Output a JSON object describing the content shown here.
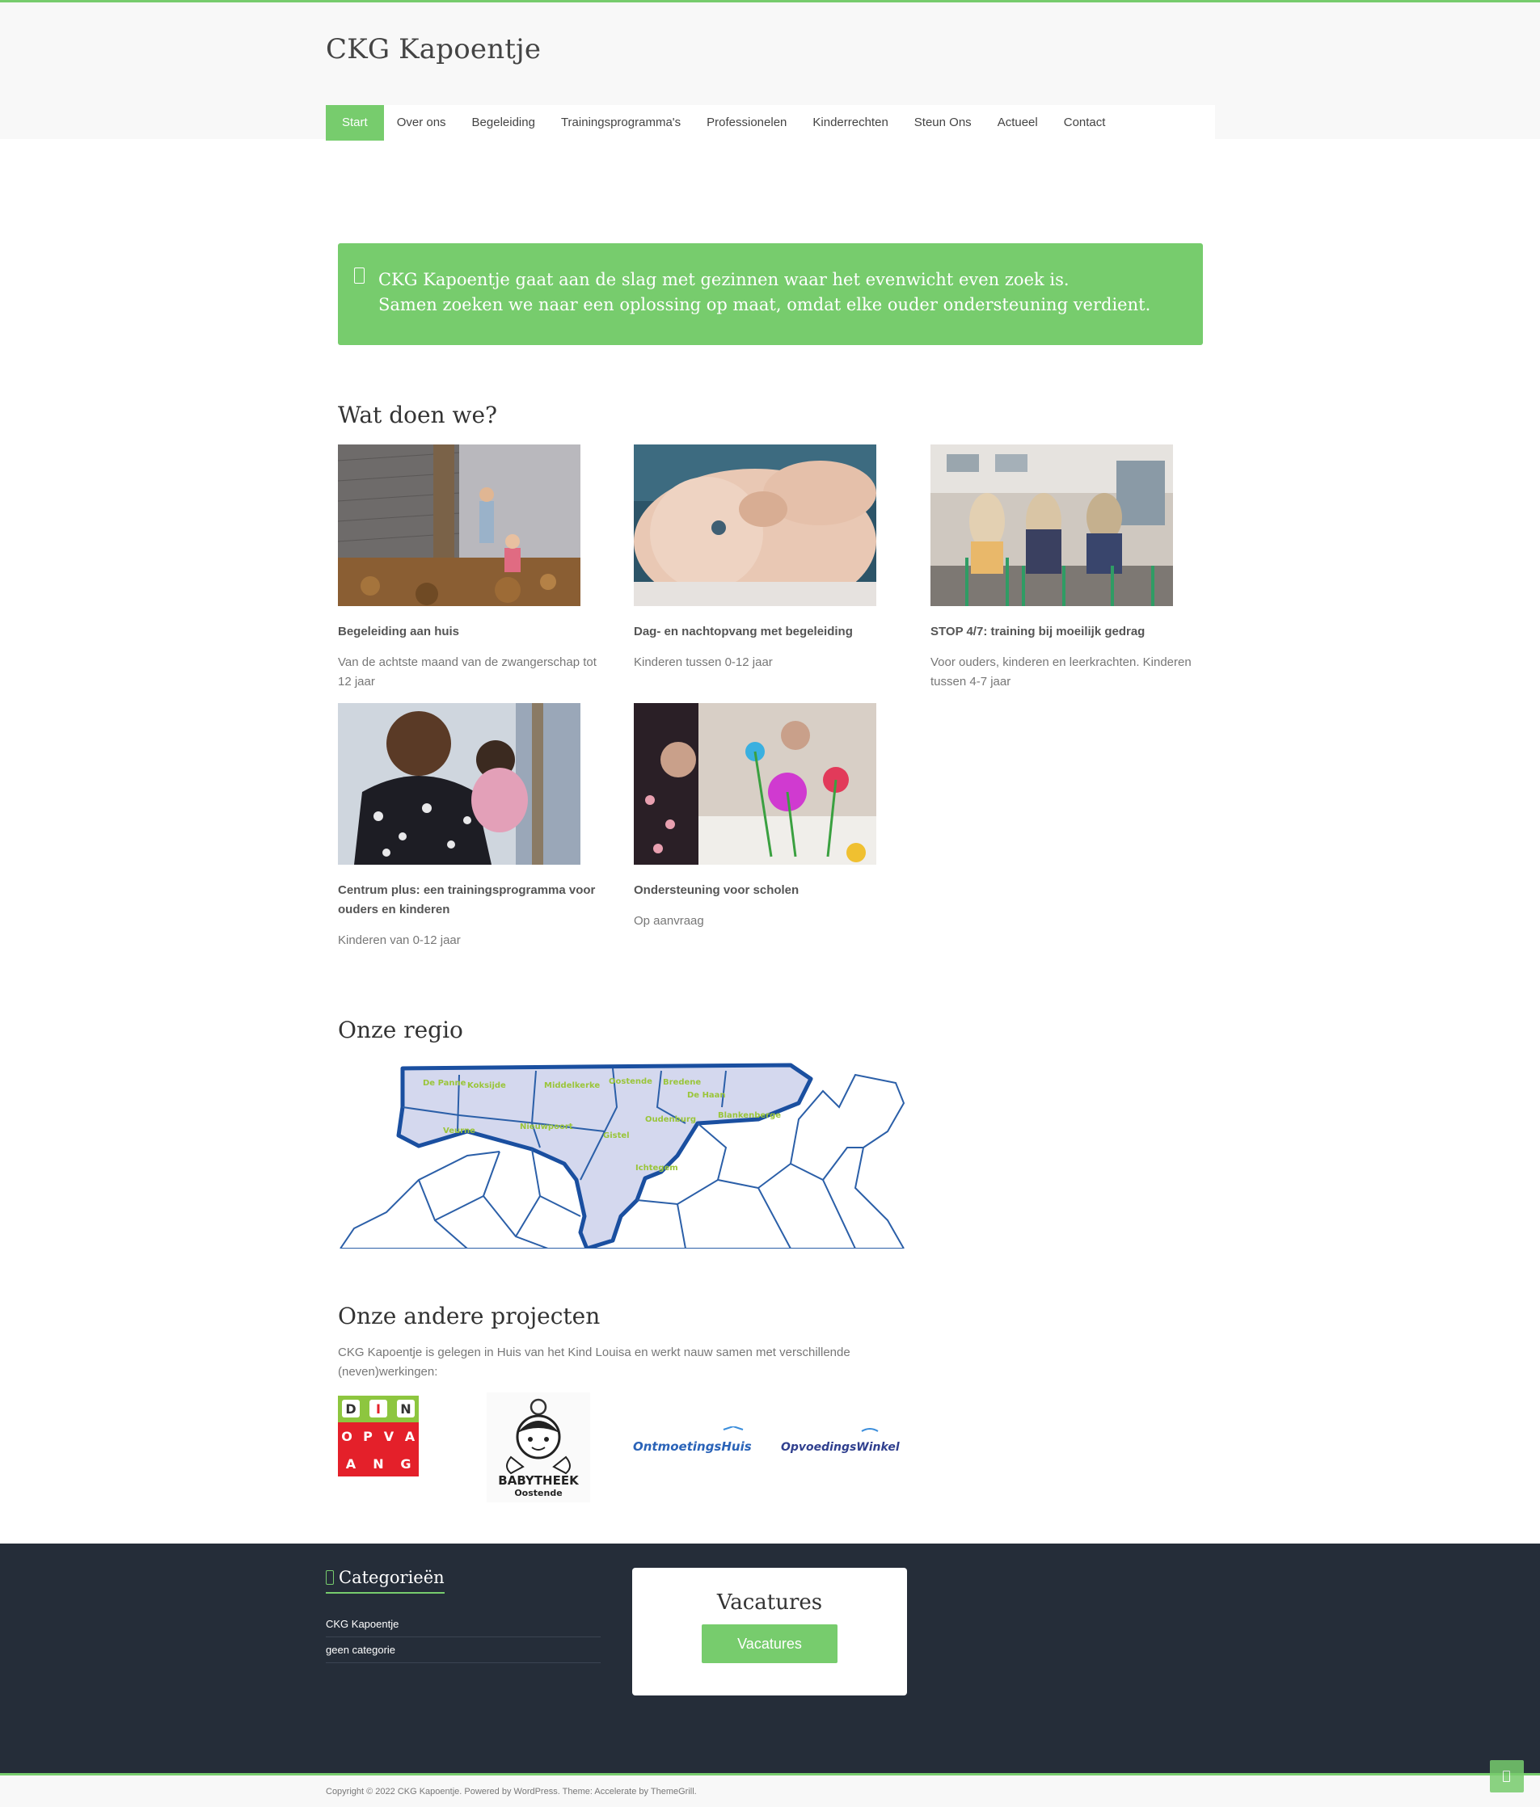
{
  "header": {
    "site_title": "CKG Kapoentje",
    "nav": [
      "Start",
      "Over ons",
      "Begeleiding",
      "Trainingsprogramma's",
      "Professionelen",
      "Kinderrechten",
      "Steun Ons",
      "Actueel",
      "Contact"
    ],
    "active_nav": "Start"
  },
  "notice": {
    "icon": "info-icon",
    "line1": "CKG Kapoentje gaat aan de slag met gezinnen waar het evenwicht even zoek is.",
    "line2": "Samen zoeken we naar een oplossing op maat, omdat elke ouder ondersteuning verdient."
  },
  "services": {
    "heading": "Wat doen we?",
    "items": [
      {
        "title": "Begeleiding aan huis",
        "desc": "Van de achtste maand van de zwangerschap tot 12 jaar"
      },
      {
        "title": "Dag- en nachtopvang met begeleiding",
        "desc": "Kinderen tussen 0-12 jaar"
      },
      {
        "title": "STOP 4/7: training bij moeilijk gedrag",
        "desc": "Voor ouders, kinderen en leerkrachten. Kinderen tussen 4-7 jaar"
      },
      {
        "title": "Centrum plus: een trainingsprogramma voor ouders en kinderen",
        "desc": "Kinderen van 0-12 jaar"
      },
      {
        "title": "Ondersteuning voor scholen",
        "desc": "Op aanvraag"
      }
    ]
  },
  "region": {
    "heading": "Onze regio",
    "map_labels": [
      "De Panne",
      "Koksijde",
      "Middelkerke",
      "Oostende",
      "Bredene",
      "De Haan",
      "Oudenburg",
      "Blankenberge",
      "Veurne",
      "Nieuwpoort",
      "Gistel",
      "Ichtegem"
    ]
  },
  "projects": {
    "heading": "Onze andere projecten",
    "intro": "CKG Kapoentje is gelegen in Huis van het Kind Louisa en werkt nauw samen met verschillende (neven)werkingen:",
    "logos": {
      "din_opvang": [
        "D",
        "I",
        "N",
        "O",
        "P",
        "V",
        "A",
        "N",
        "G"
      ],
      "babytheek": [
        "BABYTHEEK",
        "Oostende"
      ],
      "ontmoetingshuis": "OntmoetingsHuis",
      "opvoedingswinkel": "OpvoedingsWinkel"
    }
  },
  "footer": {
    "categories_title": "Categorieën",
    "categories": [
      "CKG Kapoentje",
      "geen categorie"
    ],
    "vacatures_title": "Vacatures",
    "vacatures_button": "Vacatures",
    "copyright": "Copyright © 2022 CKG Kapoentje. Powered by WordPress. Theme: Accelerate by ThemeGrill."
  },
  "colors": {
    "accent": "#77cc6d",
    "footer_bg": "#252d39",
    "header_bg": "#f8f8f8"
  }
}
